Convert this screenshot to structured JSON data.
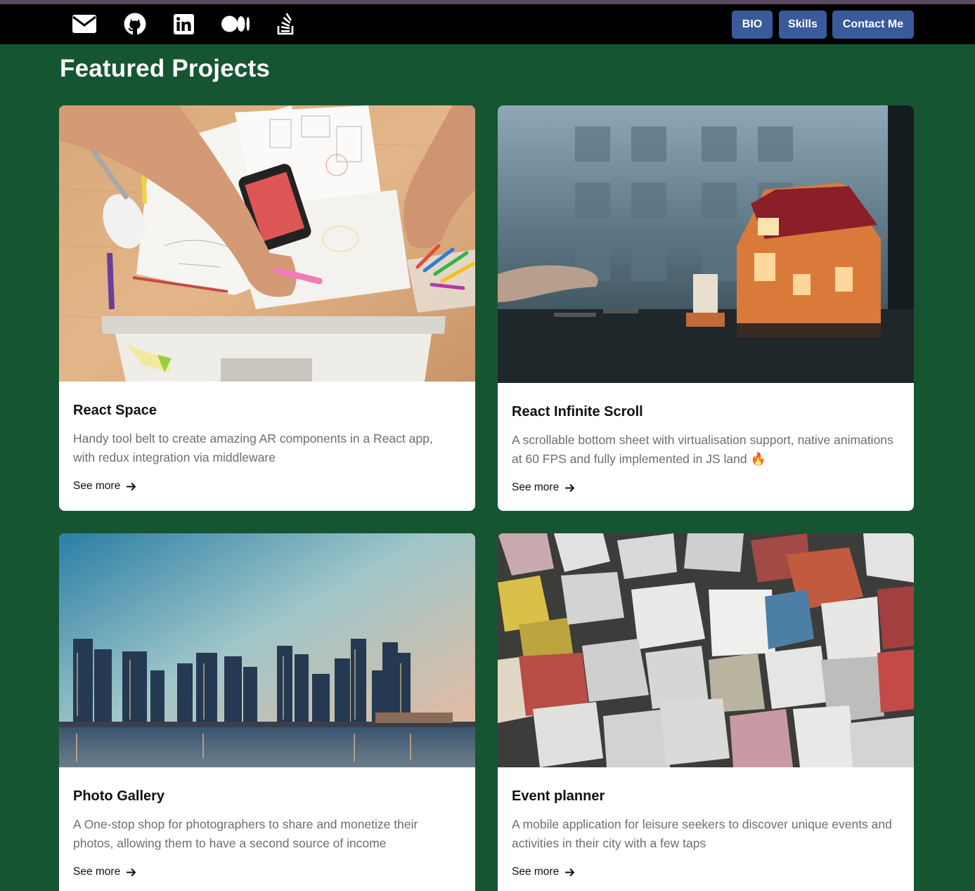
{
  "nav": {
    "icons": [
      "mail-icon",
      "github-icon",
      "linkedin-icon",
      "medium-icon",
      "stackoverflow-icon"
    ],
    "buttons": {
      "bio": "BIO",
      "skills": "Skills",
      "contact": "Contact Me"
    }
  },
  "section": {
    "title": "Featured Projects"
  },
  "projects": [
    {
      "title": "React Space",
      "description": "Handy tool belt to create amazing AR components in a React app, with redux integration via middleware",
      "link": "See more",
      "image": "desk-workspace-photo"
    },
    {
      "title": "React Infinite Scroll",
      "description": "A scrollable bottom sheet with virtualisation support, native animations at 60 FPS and fully implemented in JS land 🔥",
      "link": "See more",
      "image": "dollhouse-photo"
    },
    {
      "title": "Photo Gallery",
      "description": "A One-stop shop for photographers to share and monetize their photos, allowing them to have a second source of income",
      "link": "See more",
      "image": "city-skyline-photo"
    },
    {
      "title": "Event planner",
      "description": "A mobile application for leisure seekers to discover unique events and activities in their city with a few taps",
      "link": "See more",
      "image": "colored-stones-photo"
    }
  ],
  "colors": {
    "background": "#165532",
    "navbar": "#000000",
    "button": "#3a5a9c",
    "card": "#ffffff",
    "description": "#6e6e6e"
  }
}
